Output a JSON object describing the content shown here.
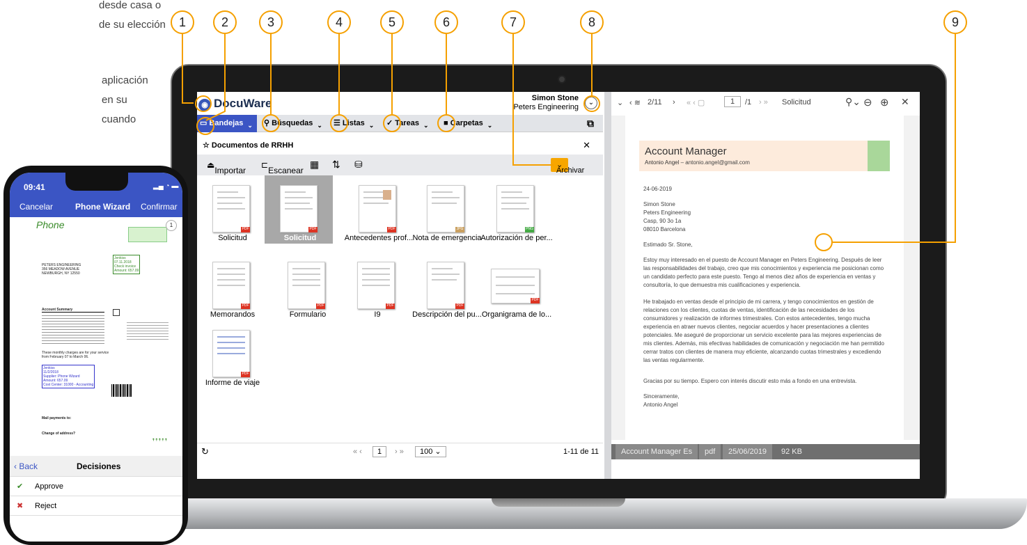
{
  "bg_text": {
    "lines": [
      "desde casa o",
      "de su elección",
      "",
      "aplicación",
      "en su",
      "cuando"
    ]
  },
  "callouts": [
    "1",
    "2",
    "3",
    "4",
    "5",
    "6",
    "7",
    "8",
    "9"
  ],
  "app": {
    "logo": "DocuWare",
    "user_name": "Simon Stone",
    "user_company": "Peters Engineering",
    "menus": [
      {
        "label": "Bandejas",
        "icon": "tray-icon"
      },
      {
        "label": "Búsquedas",
        "icon": "search-icon"
      },
      {
        "label": "Listas",
        "icon": "list-icon"
      },
      {
        "label": "Tareas",
        "icon": "check-icon"
      },
      {
        "label": "Carpetas",
        "icon": "folder-icon"
      }
    ],
    "doc_title": "Documentos de RRHH",
    "tools": {
      "import": "Importar",
      "scan": "Escanear",
      "archive": "Archivar"
    },
    "tiles": [
      "Solicitud",
      "Solicitud",
      "Antecedentes prof...",
      "Nota de emergencia",
      "Autorización de per...",
      "Memorandos",
      "Formulario",
      "I9",
      "Descripción del pu...",
      "Organigrama de lo...",
      "Informe de viaje"
    ],
    "pager": {
      "page": "1",
      "size": "100",
      "range": "1-11 de 11"
    }
  },
  "viewer": {
    "doc_counter": "2/11",
    "page": "1",
    "page_total": "/1",
    "doc_type": "Solicitud",
    "letter": {
      "title": "Account Manager",
      "name": "Antonio Angel",
      "contact": " – antonio.angel@gmail.com",
      "date": "24-06-2019",
      "address": [
        "Simon Stone",
        "Peters Engineering",
        "Casp, 90 3o 1a",
        "08010 Barcelona"
      ],
      "greeting": "Estimado Sr. Stone,",
      "p1": "Estoy muy interesado en el puesto de Account Manager en Peters Engineering. Después de leer las responsabilidades del trabajo, creo que mis conocimientos y experiencia me posicionan como un candidato perfecto para este puesto. Tengo al menos diez años de experiencia en ventas y consultoría, lo que demuestra mis cualificaciones y experiencia.",
      "p2": "He trabajado en ventas desde el principio de mi carrera, y tengo conocimientos en gestión de relaciones con los clientes, cuotas de ventas, identificación de las necesidades de los consumidores y realización de informes trimestrales. Con estos antecedentes, tengo mucha experiencia en atraer nuevos clientes, negociar acuerdos y hacer presentaciones a clientes potenciales. Me aseguré de proporcionar un servicio excelente para las mejores experiencias de mis clientes. Además, mis efectivas habilidades de comunicación y negociación me han permitido cerrar tratos con clientes de manera muy eficiente, alcanzando cuotas trimestrales y excediendo las ventas regularmente.",
      "p3": "Gracias por su tiempo. Espero con interés discutir esto más a fondo en una entrevista.",
      "closing": "Sinceramente,",
      "signature": "Antonio Angel"
    },
    "status": {
      "name": "Account Manager Es",
      "type": "pdf",
      "date": "25/06/2019",
      "size": "92 KB"
    }
  },
  "phone": {
    "time": "09:41",
    "cancel": "Cancelar",
    "title": "Phone Wizard",
    "confirm": "Confirmar",
    "badge": "1",
    "doc": {
      "address": [
        "PETERS ENGINEERING",
        "356 MEADOW AVENUE",
        "NEWBURGH, NY 12550"
      ],
      "stamp": [
        "Jenkiss",
        "07.11.2018",
        "Check invoice",
        "Amount: 657.09"
      ],
      "summary_title": "Account Summary",
      "note": "These monthly charges are for your service from February 07 to March 06.",
      "stamp2": [
        "Jenkiss",
        "11/2/2018",
        "Supplier: Phone Wizard",
        "Amount: 657.09",
        "Cost Center: 31000 - Accounting"
      ],
      "mail": "Mail payments to:",
      "change": "Change of address?"
    },
    "back": "Back",
    "decisions": "Decisiones",
    "approve": "Approve",
    "reject": "Reject"
  }
}
